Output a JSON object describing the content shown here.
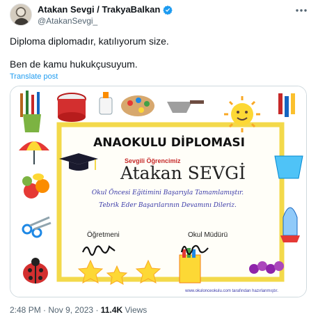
{
  "tweet": {
    "display_name": "Atakan Sevgi / TrakyaBalkan",
    "handle": "@AtakanSevgi_",
    "text_line1": "Diploma diplomadır, katılıyorum size.",
    "text_line2": "Ben de kamu hukukçusuyum.",
    "translate_label": "Translate post",
    "time": "2:48 PM",
    "date": "Nov 9, 2023",
    "separator": "·",
    "views_count": "11.4K",
    "views_label": "Views"
  },
  "diploma": {
    "title": "ANAOKULU DİPLOMASI",
    "greeting": "Sevgili Öğrencimiz",
    "student_name": "Atakan SEVGİ",
    "body_line1": "Okul Öncesi Eğitimini Başarıyla Tamamlamıştır.",
    "body_line2": "Tebrik Eder Başarılarının Devamını Dileriz.",
    "teacher_label": "Öğretmeni",
    "principal_label": "Okul Müdürü",
    "footer": "www.okulonceokulu.com tarafından hazırlanmıştır."
  },
  "colors": {
    "accent": "#1d9bf0",
    "secondary_text": "#536471",
    "frame_yellow": "#f3d94a",
    "diploma_blue": "#3a3aa8"
  },
  "icons": [
    "verified-badge-icon",
    "more-icon",
    "graduation-cap-icon"
  ]
}
